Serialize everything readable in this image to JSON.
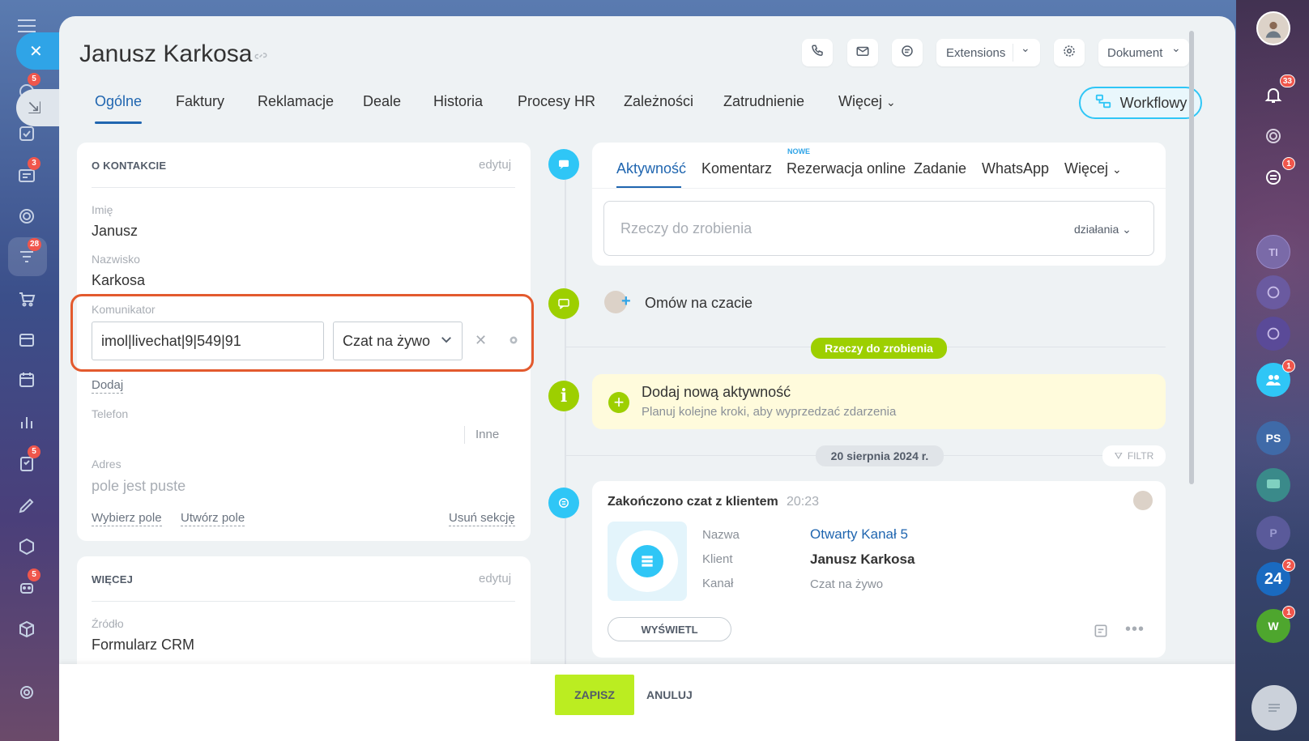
{
  "window": {
    "title": "Janusz Karkosa"
  },
  "header": {
    "extensions_label": "Extensions",
    "document_label": "Dokument",
    "workflow_label": "Workflowy"
  },
  "tabs": [
    "Ogólne",
    "Faktury",
    "Reklamacje",
    "Deale",
    "Historia",
    "Procesy HR",
    "Zależności",
    "Zatrudnienie",
    "Więcej"
  ],
  "about": {
    "section_title": "O KONTAKCIE",
    "edit_label": "edytuj",
    "first_name_label": "Imię",
    "first_name": "Janusz",
    "last_name_label": "Nazwisko",
    "last_name": "Karkosa",
    "messenger_label": "Komunikator",
    "messenger_value": "imol|livechat|9|549|91",
    "messenger_type": "Czat na żywo",
    "add_label": "Dodaj",
    "phone_label": "Telefon",
    "phone_other": "Inne",
    "address_label": "Adres",
    "address_empty": "pole jest puste",
    "select_field": "Wybierz pole",
    "create_field": "Utwórz pole",
    "delete_section": "Usuń sekcję"
  },
  "more": {
    "section_title": "WIĘCEJ",
    "edit_label": "edytuj",
    "source_label": "Źródło",
    "source_value": "Formularz CRM"
  },
  "activity": {
    "tabs": [
      "Aktywność",
      "Komentarz",
      "Rezerwacja online",
      "Zadanie",
      "WhatsApp",
      "Więcej"
    ],
    "new_badge": "NOWE",
    "todo_placeholder": "Rzeczy do zrobienia",
    "actions_label": "działania",
    "chat_label": "Omów na czacie",
    "todo_pill": "Rzeczy do zrobienia",
    "add_activity_title": "Dodaj nową aktywność",
    "add_activity_sub": "Planuj kolejne kroki, aby wyprzedzać zdarzenia",
    "date_pill": "20 sierpnia 2024 r.",
    "filter_label": "FILTR"
  },
  "chat_card": {
    "title": "Zakończono czat z klientem",
    "time": "20:23",
    "name_label": "Nazwa",
    "name_value": "Otwarty Kanał 5",
    "client_label": "Klient",
    "client_value": "Janusz Karkosa",
    "channel_label": "Kanał",
    "channel_value": "Czat na żywo",
    "view_button": "WYŚWIETL"
  },
  "footer": {
    "save": "ZAPISZ",
    "cancel": "ANULUJ"
  },
  "left_sidebar": {
    "badges": [
      "5",
      "3",
      "28",
      "5",
      "5"
    ]
  },
  "right_sidebar": {
    "notifications_badge": "33",
    "chat_badge": "1",
    "group_badge": "1",
    "b24_badge": "2",
    "w_badge": "1",
    "ti": "TI",
    "ps": "PS",
    "p": "P",
    "b24": "24",
    "w": "W"
  }
}
